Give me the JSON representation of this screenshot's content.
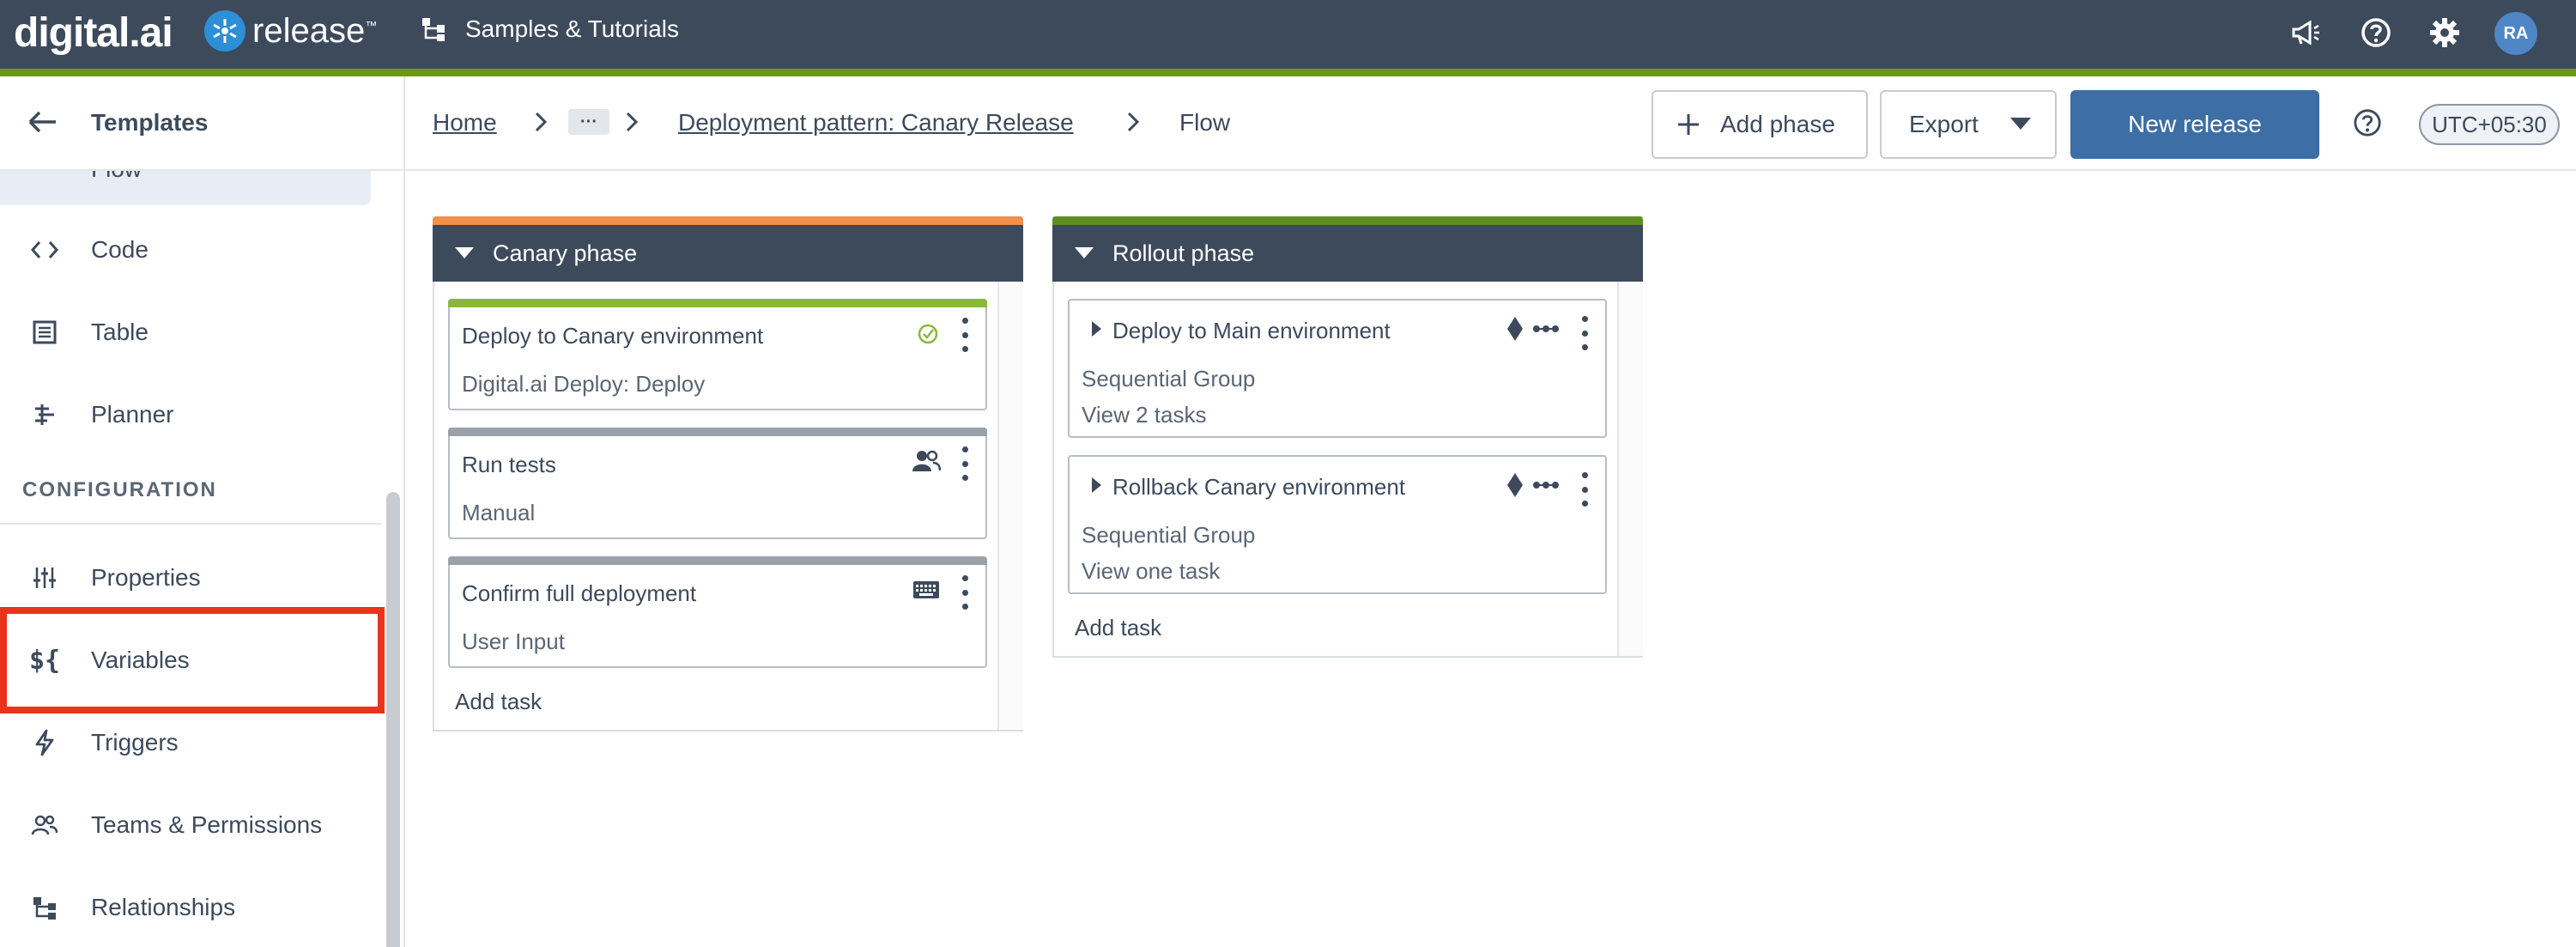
{
  "topbar": {
    "brand_digital": "digital.ai",
    "brand_release": "release",
    "brand_tm": "™",
    "samples_label": "Samples & Tutorials",
    "avatar_initials": "RA",
    "icons": [
      "megaphone-icon",
      "help-icon",
      "gear-icon"
    ],
    "accent_color": "#6a9a14",
    "bg_color": "#3d4a5c"
  },
  "sidebar": {
    "title": "Templates",
    "flow_label": "Flow",
    "items_top": [
      {
        "label": "Code",
        "icon": "code-icon"
      },
      {
        "label": "Table",
        "icon": "table-icon"
      },
      {
        "label": "Planner",
        "icon": "planner-icon"
      }
    ],
    "section": "CONFIGURATION",
    "items_config": [
      {
        "label": "Properties",
        "icon": "sliders-icon"
      },
      {
        "label": "Variables",
        "icon": "variables-icon"
      },
      {
        "label": "Triggers",
        "icon": "bolt-icon"
      },
      {
        "label": "Teams & Permissions",
        "icon": "team-icon"
      },
      {
        "label": "Relationships",
        "icon": "relationships-icon"
      }
    ],
    "highlight_color": "#e8341c"
  },
  "breadcrumb": {
    "home": "Home",
    "ellipsis": "···",
    "template": "Deployment pattern: Canary Release",
    "current": "Flow"
  },
  "toolbar": {
    "add_phase": "Add phase",
    "export": "Export",
    "new_release": "New release",
    "timezone": "UTC+05:30"
  },
  "phases": [
    {
      "title": "Canary phase",
      "color": "#f0904a",
      "add_task": "Add task",
      "tasks": [
        {
          "title": "Deploy to Canary environment",
          "subtitle": "Digital.ai Deploy: Deploy",
          "bar_color": "#8ab83a",
          "icon": "deploy-check-icon"
        },
        {
          "title": "Run tests",
          "subtitle": "Manual",
          "bar_color": "#9aa1a9",
          "icon": "users-icon"
        },
        {
          "title": "Confirm full deployment",
          "subtitle": "User Input",
          "bar_color": "#9aa1a9",
          "icon": "keyboard-icon"
        }
      ]
    },
    {
      "title": "Rollout phase",
      "color": "#5e8f1c",
      "add_task": "Add task",
      "groups": [
        {
          "title": "Deploy to Main environment",
          "type": "Sequential Group",
          "link": "View 2 tasks"
        },
        {
          "title": "Rollback Canary environment",
          "type": "Sequential Group",
          "link": "View one task"
        }
      ]
    }
  ]
}
